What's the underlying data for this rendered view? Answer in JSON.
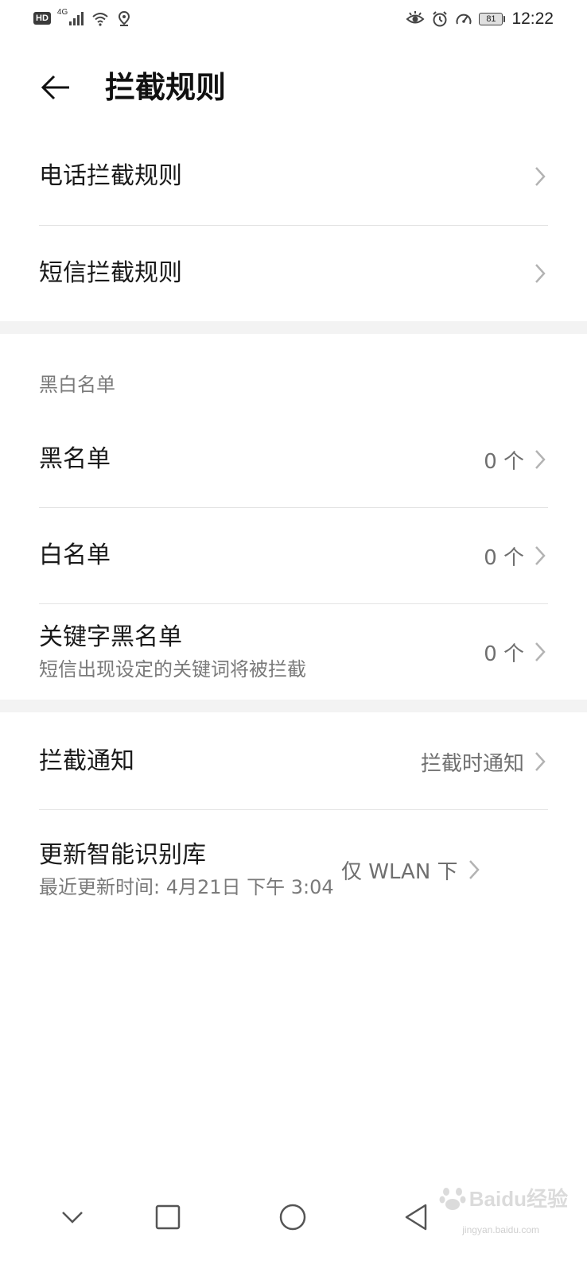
{
  "status_bar": {
    "hd_label": "HD",
    "network_label": "4G",
    "battery_level": "81",
    "time": "12:22"
  },
  "header": {
    "title": "拦截规则"
  },
  "rules_section": {
    "items": [
      {
        "title": "电话拦截规则"
      },
      {
        "title": "短信拦截规则"
      }
    ]
  },
  "list_section": {
    "header": "黑白名单",
    "items": [
      {
        "title": "黑名单",
        "value": "0 个"
      },
      {
        "title": "白名单",
        "value": "0 个"
      },
      {
        "title": "关键字黑名单",
        "subtitle": "短信出现设定的关键词将被拦截",
        "value": "0 个"
      }
    ]
  },
  "settings_section": {
    "items": [
      {
        "title": "拦截通知",
        "value": "拦截时通知"
      },
      {
        "title": "更新智能识别库",
        "subtitle": "最近更新时间: 4月21日 下午 3:04",
        "value": "仅 WLAN 下"
      }
    ]
  },
  "watermark": {
    "brand": "Baidu经验",
    "site": "jingyan.baidu.com"
  },
  "colors": {
    "background": "#ffffff",
    "section_gap": "#f3f3f3",
    "divider": "#e3e3e3",
    "primary_text": "#1a1a1a",
    "secondary_text": "#7a7a7a"
  },
  "icons": {
    "back": "arrow-left-icon",
    "chevron": "chevron-right-icon",
    "nav": [
      "chevron-down-icon",
      "square-icon",
      "circle-icon",
      "triangle-back-icon"
    ]
  }
}
